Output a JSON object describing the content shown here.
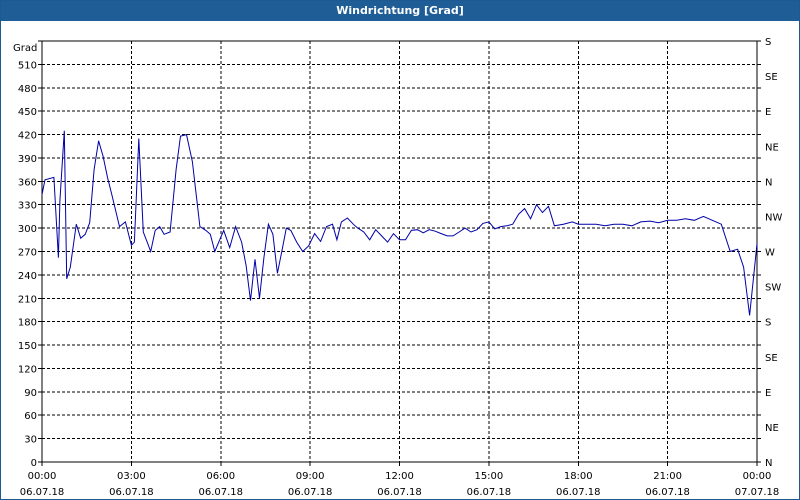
{
  "window": {
    "title": "Windrichtung [Grad]"
  },
  "colors": {
    "titlebar": "#1f5d97",
    "line": "#0000aa",
    "grid": "#000000",
    "background": "#ffffff"
  },
  "chart_data": {
    "type": "line",
    "title": "Windrichtung [Grad]",
    "ylabel": "Grad",
    "ylim": [
      0,
      540
    ],
    "yticks": [
      0,
      30,
      60,
      90,
      120,
      150,
      180,
      210,
      240,
      270,
      300,
      330,
      360,
      390,
      420,
      450,
      480,
      510
    ],
    "right_axis_labels": [
      "N",
      "NE",
      "E",
      "SE",
      "S",
      "SW",
      "W",
      "NW",
      "N",
      "NE",
      "E",
      "SE",
      "S"
    ],
    "xlim_hours": [
      0,
      24
    ],
    "x_ticks": [
      {
        "time": "00:00",
        "date": "06.07.18"
      },
      {
        "time": "03:00",
        "date": "06.07.18"
      },
      {
        "time": "06:00",
        "date": "06.07.18"
      },
      {
        "time": "09:00",
        "date": "06.07.18"
      },
      {
        "time": "12:00",
        "date": "06.07.18"
      },
      {
        "time": "15:00",
        "date": "06.07.18"
      },
      {
        "time": "18:00",
        "date": "06.07.18"
      },
      {
        "time": "21:00",
        "date": "06.07.18"
      },
      {
        "time": "00:00",
        "date": "07.07.18"
      }
    ],
    "grid": true,
    "series": [
      {
        "x": [
          0.0,
          0.1,
          0.4,
          0.55,
          0.6,
          0.75,
          0.83,
          0.95,
          1.15,
          1.3,
          1.45,
          1.6,
          1.75,
          1.9,
          2.05,
          2.2,
          2.35,
          2.6,
          2.8,
          3.0,
          3.1,
          3.25,
          3.4,
          3.55,
          3.65,
          3.8,
          3.95,
          4.1,
          4.3,
          4.5,
          4.65,
          4.85,
          5.05,
          5.3,
          5.5,
          5.65,
          5.8,
          6.1,
          6.3,
          6.5,
          6.7,
          6.85,
          7.0,
          7.15,
          7.3,
          7.45,
          7.6,
          7.75,
          7.9,
          8.05,
          8.2,
          8.35,
          8.55,
          8.75,
          8.95,
          9.15,
          9.35,
          9.55,
          9.75,
          9.9,
          10.05,
          10.25,
          10.45,
          10.6,
          10.8,
          11.0,
          11.2,
          11.4,
          11.6,
          11.8,
          12.0,
          12.2,
          12.4,
          12.6,
          12.8,
          13.0,
          13.2,
          13.4,
          13.6,
          13.8,
          14.0,
          14.2,
          14.4,
          14.6,
          14.8,
          15.0,
          15.2,
          15.4,
          15.6,
          15.8,
          16.0,
          16.2,
          16.4,
          16.6,
          16.8,
          17.0,
          17.2,
          17.5,
          17.8,
          18.0,
          18.3,
          18.6,
          18.9,
          19.2,
          19.5,
          19.8,
          20.1,
          20.4,
          20.7,
          21.0,
          21.3,
          21.6,
          21.9,
          22.2,
          22.5,
          22.8,
          23.1,
          23.35,
          23.55,
          23.75,
          24.0
        ],
        "values": [
          343,
          362,
          365,
          262,
          335,
          425,
          235,
          250,
          305,
          287,
          292,
          307,
          375,
          412,
          392,
          365,
          342,
          302,
          308,
          278,
          282,
          415,
          295,
          280,
          270,
          297,
          302,
          292,
          295,
          375,
          418,
          420,
          385,
          302,
          297,
          292,
          270,
          297,
          275,
          302,
          282,
          252,
          207,
          260,
          210,
          262,
          305,
          292,
          242,
          270,
          300,
          297,
          282,
          270,
          277,
          293,
          283,
          302,
          305,
          285,
          308,
          313,
          305,
          300,
          295,
          285,
          298,
          290,
          282,
          293,
          285,
          285,
          297,
          298,
          294,
          298,
          296,
          293,
          290,
          290,
          295,
          300,
          295,
          298,
          306,
          308,
          299,
          302,
          303,
          305,
          318,
          325,
          312,
          330,
          320,
          328,
          303,
          305,
          308,
          305,
          305,
          305,
          303,
          305,
          305,
          303,
          308,
          309,
          307,
          310,
          310,
          312,
          310,
          315,
          310,
          305,
          270,
          273,
          250,
          188,
          280
        ]
      }
    ]
  }
}
